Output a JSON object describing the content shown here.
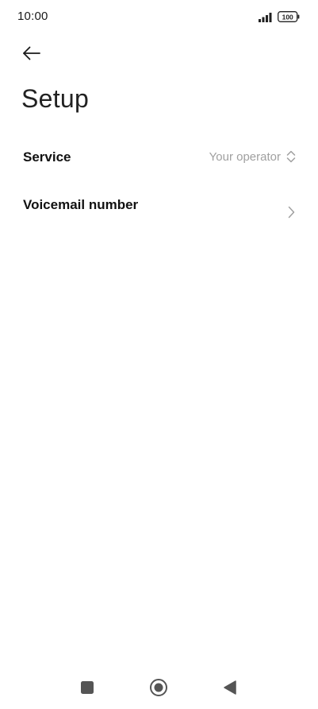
{
  "status_bar": {
    "time": "10:00",
    "signal_icon": "signal-bars-icon",
    "battery_icon": "battery-icon",
    "battery_level": "100"
  },
  "header": {
    "back_icon": "arrow-left-icon",
    "title": "Setup"
  },
  "settings": {
    "items": [
      {
        "label": "Service",
        "value": "Your operator",
        "icon": "chevron-up-down-icon"
      },
      {
        "label": "Voicemail number",
        "icon": "chevron-right-icon"
      }
    ]
  },
  "nav_bar": {
    "recents_icon": "square-icon",
    "home_icon": "circle-home-icon",
    "back_icon": "triangle-back-icon"
  },
  "colors": {
    "background": "#ffffff",
    "text_primary": "#111111",
    "text_secondary": "#a0a0a0",
    "nav_icons": "#555555"
  }
}
